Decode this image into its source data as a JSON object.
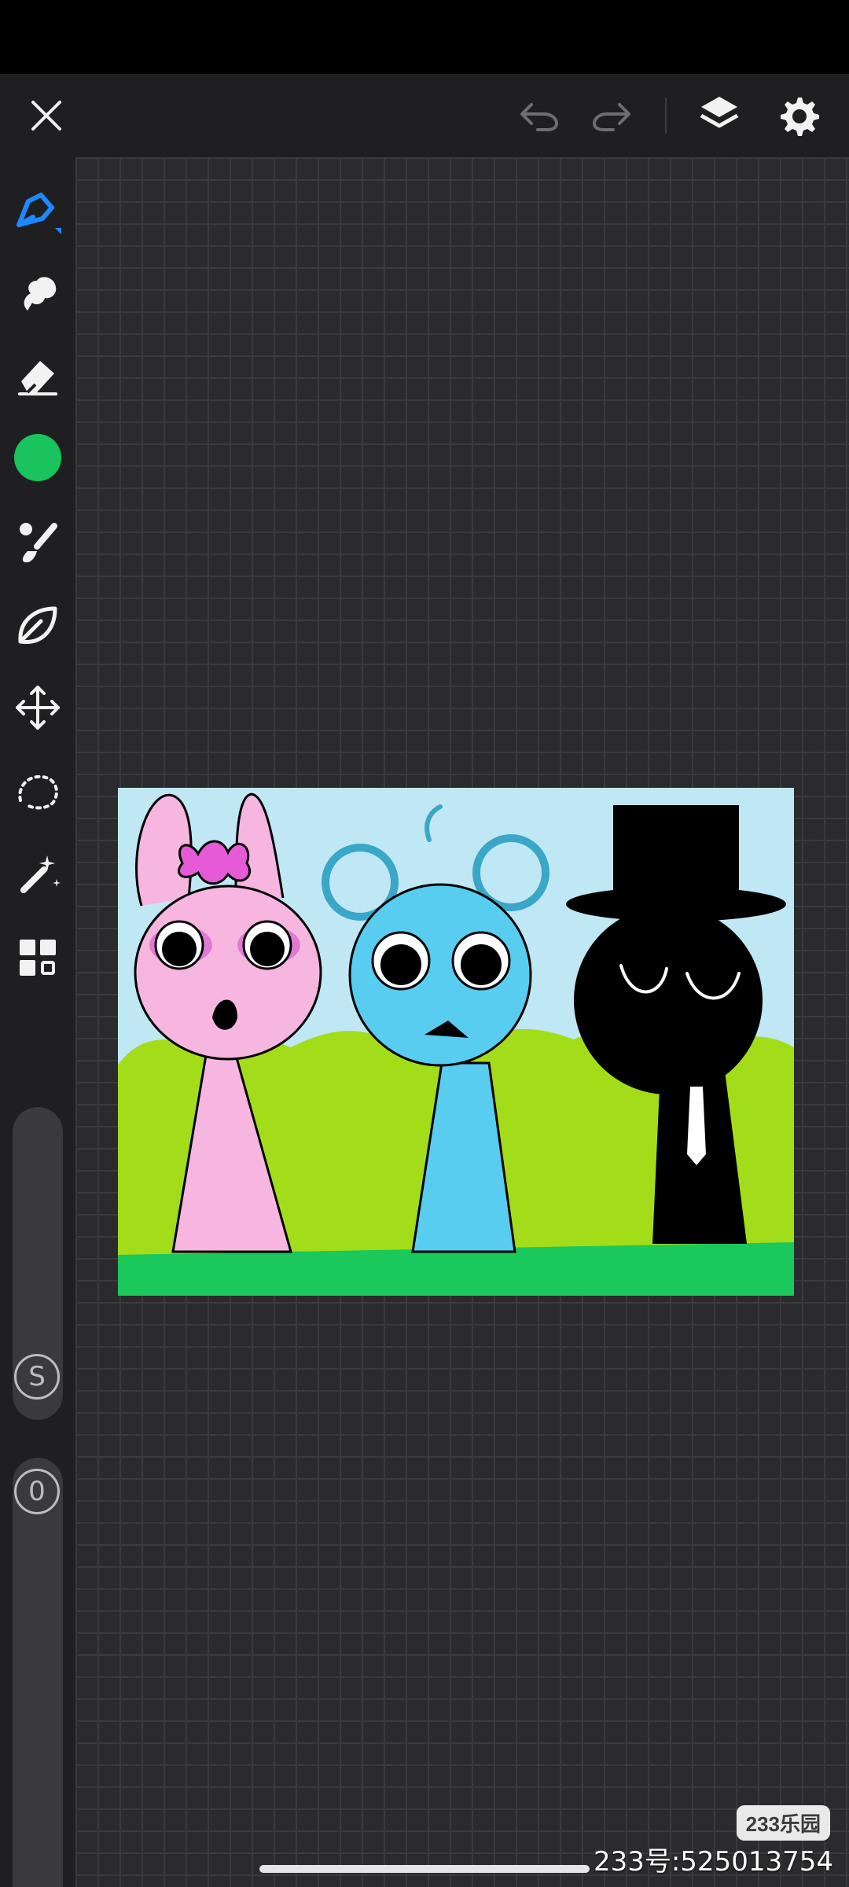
{
  "app": {
    "toolbar": {
      "close": "close-icon",
      "undo": "undo-icon",
      "redo": "redo-icon",
      "layers": "layers-icon",
      "settings": "gear-icon"
    },
    "tools": [
      {
        "name": "pen-tool",
        "icon": "pen-nib-icon",
        "active": true
      },
      {
        "name": "smudge-tool",
        "icon": "smudge-icon"
      },
      {
        "name": "eraser-tool",
        "icon": "eraser-icon"
      },
      {
        "name": "color-picker",
        "icon": "color-circle-icon",
        "color": "#19c35d"
      },
      {
        "name": "brush-tool",
        "icon": "brush-icon"
      },
      {
        "name": "fill-tool",
        "icon": "leaf-icon"
      },
      {
        "name": "move-tool",
        "icon": "move-arrows-icon"
      },
      {
        "name": "lasso-tool",
        "icon": "lasso-icon"
      },
      {
        "name": "magic-tool",
        "icon": "magic-wand-icon"
      },
      {
        "name": "apps-tool",
        "icon": "grid-apps-icon"
      }
    ],
    "sliders": {
      "size_badge": "S",
      "opacity_badge": "0"
    },
    "colors": {
      "accent": "#1e88ff",
      "current_color": "#19c35d"
    }
  },
  "overlay": {
    "brand": "233乐园",
    "uid": "233号:525013754"
  }
}
